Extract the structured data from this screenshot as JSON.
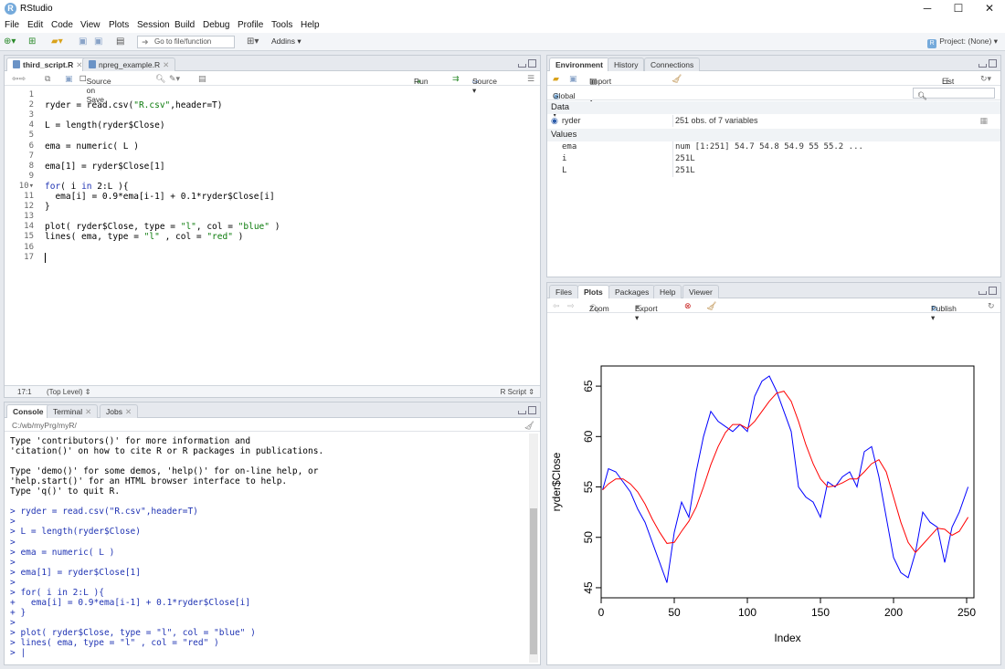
{
  "window": {
    "title": "RStudio",
    "min": "─",
    "max": "☐",
    "close": "✕"
  },
  "menu": [
    "File",
    "Edit",
    "Code",
    "View",
    "Plots",
    "Session",
    "Build",
    "Debug",
    "Profile",
    "Tools",
    "Help"
  ],
  "toolbar": {
    "goto_placeholder": "Go to file/function",
    "addins": "Addins ▾",
    "project": "Project: (None) ▾"
  },
  "editor": {
    "tabs": [
      {
        "label": "third_script.R",
        "active": true
      },
      {
        "label": "npreg_example.R",
        "active": false
      }
    ],
    "source_on_save": "Source on Save",
    "run": "Run",
    "source": "Source ▾",
    "status_pos": "17:1",
    "status_scope": "(Top Level) ⇕",
    "status_type": "R Script ⇕",
    "lines": [
      "",
      "ryder = read.csv(\"R.csv\",header=T)",
      "",
      "L = length(ryder$Close)",
      "",
      "ema = numeric( L )",
      "",
      "ema[1] = ryder$Close[1]",
      "",
      "for( i in 2:L ){",
      "  ema[i] = 0.9*ema[i-1] + 0.1*ryder$Close[i]",
      "}",
      "",
      "plot( ryder$Close, type = \"l\", col = \"blue\" )",
      "lines( ema, type = \"l\" , col = \"red\" )",
      "",
      ""
    ]
  },
  "console": {
    "tabs": [
      {
        "label": "Console",
        "active": true
      },
      {
        "label": "Terminal",
        "active": false
      },
      {
        "label": "Jobs",
        "active": false
      }
    ],
    "path": "C:/wb/myPrg/myR/",
    "output": [
      {
        "t": "Type 'contributors()' for more information and",
        "c": false
      },
      {
        "t": "'citation()' on how to cite R or R packages in publications.",
        "c": false
      },
      {
        "t": "",
        "c": false
      },
      {
        "t": "Type 'demo()' for some demos, 'help()' for on-line help, or",
        "c": false
      },
      {
        "t": "'help.start()' for an HTML browser interface to help.",
        "c": false
      },
      {
        "t": "Type 'q()' to quit R.",
        "c": false
      },
      {
        "t": "",
        "c": false
      },
      {
        "t": "> ryder = read.csv(\"R.csv\",header=T)",
        "c": true
      },
      {
        "t": ">",
        "c": true
      },
      {
        "t": "> L = length(ryder$Close)",
        "c": true
      },
      {
        "t": ">",
        "c": true
      },
      {
        "t": "> ema = numeric( L )",
        "c": true
      },
      {
        "t": ">",
        "c": true
      },
      {
        "t": "> ema[1] = ryder$Close[1]",
        "c": true
      },
      {
        "t": ">",
        "c": true
      },
      {
        "t": "> for( i in 2:L ){",
        "c": true
      },
      {
        "t": "+   ema[i] = 0.9*ema[i-1] + 0.1*ryder$Close[i]",
        "c": true
      },
      {
        "t": "+ }",
        "c": true
      },
      {
        "t": ">",
        "c": true
      },
      {
        "t": "> plot( ryder$Close, type = \"l\", col = \"blue\" )",
        "c": true
      },
      {
        "t": "> lines( ema, type = \"l\" , col = \"red\" )",
        "c": true
      },
      {
        "t": "> |",
        "c": true
      }
    ]
  },
  "environment": {
    "tabs": [
      {
        "label": "Environment",
        "active": true
      },
      {
        "label": "History",
        "active": false
      },
      {
        "label": "Connections",
        "active": false
      }
    ],
    "import": "Import Dataset ▾",
    "list": "List ▾",
    "scope": "Global Environment ▾",
    "sec_data": "Data",
    "sec_values": "Values",
    "data": [
      {
        "name": "ryder",
        "value": "251 obs. of 7 variables"
      }
    ],
    "values": [
      {
        "name": "ema",
        "value": "num [1:251] 54.7 54.8 54.9 55 55.2 ..."
      },
      {
        "name": "i",
        "value": "251L"
      },
      {
        "name": "L",
        "value": "251L"
      }
    ]
  },
  "plots": {
    "tabs": [
      {
        "label": "Files",
        "active": false
      },
      {
        "label": "Plots",
        "active": true
      },
      {
        "label": "Packages",
        "active": false
      },
      {
        "label": "Help",
        "active": false
      },
      {
        "label": "Viewer",
        "active": false
      }
    ],
    "zoom": "Zoom",
    "export": "Export ▾",
    "publish": "Publish ▾"
  },
  "chart_data": {
    "type": "line",
    "xlabel": "Index",
    "ylabel": "ryder$Close",
    "xlim": [
      0,
      255
    ],
    "ylim": [
      44,
      67
    ],
    "xticks": [
      0,
      50,
      100,
      150,
      200,
      250
    ],
    "yticks": [
      45,
      50,
      55,
      60,
      65
    ],
    "series": [
      {
        "color": "#0000ff",
        "x": [
          1,
          5,
          10,
          15,
          20,
          25,
          30,
          35,
          40,
          45,
          50,
          55,
          60,
          65,
          70,
          75,
          80,
          85,
          90,
          95,
          100,
          105,
          110,
          115,
          120,
          125,
          130,
          135,
          140,
          145,
          150,
          155,
          160,
          165,
          170,
          175,
          180,
          185,
          190,
          195,
          200,
          205,
          210,
          215,
          220,
          225,
          230,
          235,
          240,
          245,
          251
        ],
        "y": [
          54.7,
          56.8,
          56.5,
          55.5,
          54.5,
          52.8,
          51.5,
          49.5,
          47.5,
          45.5,
          50.5,
          53.5,
          52.0,
          56.5,
          60.0,
          62.5,
          61.5,
          61.0,
          60.5,
          61.2,
          60.5,
          64.0,
          65.5,
          66.0,
          64.5,
          62.5,
          60.5,
          55.0,
          54.0,
          53.5,
          52.0,
          55.5,
          55.0,
          56.0,
          56.5,
          55.0,
          58.5,
          59.0,
          56.0,
          52.0,
          48.0,
          46.5,
          46.0,
          48.5,
          52.5,
          51.5,
          51.0,
          47.5,
          51.0,
          52.5,
          55.0
        ]
      },
      {
        "color": "#ff0000",
        "x": [
          1,
          5,
          10,
          15,
          20,
          25,
          30,
          35,
          40,
          45,
          50,
          55,
          60,
          65,
          70,
          75,
          80,
          85,
          90,
          95,
          100,
          105,
          110,
          115,
          120,
          125,
          130,
          135,
          140,
          145,
          150,
          155,
          160,
          165,
          170,
          175,
          180,
          185,
          190,
          195,
          200,
          205,
          210,
          215,
          220,
          225,
          230,
          235,
          240,
          245,
          251
        ],
        "y": [
          54.7,
          55.3,
          55.8,
          55.8,
          55.3,
          54.5,
          53.3,
          51.8,
          50.5,
          49.4,
          49.5,
          50.6,
          51.6,
          53.0,
          55.0,
          57.2,
          59.0,
          60.4,
          61.2,
          61.2,
          60.8,
          61.5,
          62.5,
          63.5,
          64.3,
          64.5,
          63.5,
          61.5,
          59.2,
          57.3,
          55.8,
          55.0,
          55.1,
          55.4,
          55.8,
          55.8,
          56.5,
          57.3,
          57.7,
          56.5,
          54.0,
          51.5,
          49.5,
          48.5,
          49.3,
          50.1,
          50.9,
          50.8,
          50.2,
          50.6,
          52.0
        ]
      }
    ]
  }
}
